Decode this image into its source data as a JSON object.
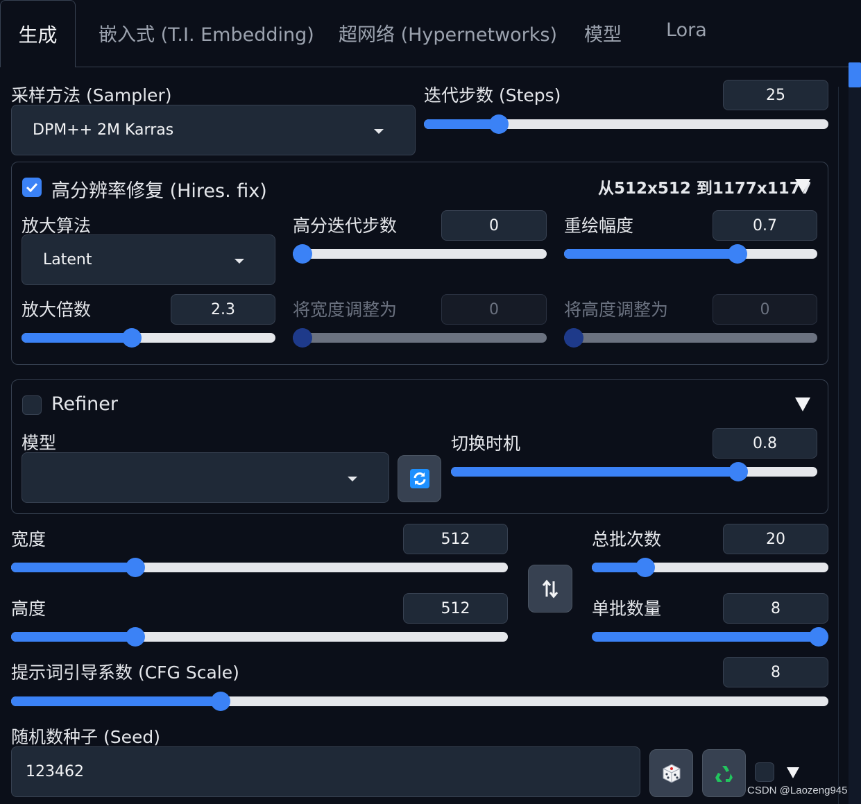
{
  "tabs": [
    {
      "label": "生成",
      "active": true
    },
    {
      "label": "嵌入式 (T.I. Embedding)"
    },
    {
      "label": "超网络 (Hypernetworks)"
    },
    {
      "label": "模型"
    },
    {
      "label": "Lora"
    }
  ],
  "sampler": {
    "label": "采样方法 (Sampler)",
    "value": "DPM++ 2M Karras"
  },
  "steps": {
    "label": "迭代步数 (Steps)",
    "value": "25",
    "level": 0.17
  },
  "hires": {
    "label": "高分辨率修复 (Hires. fix)",
    "checked": true,
    "summary": "从512x512 到1177x1177",
    "upscaler": {
      "label": "放大算法",
      "value": "Latent"
    },
    "hires_steps": {
      "label": "高分迭代步数",
      "value": "0",
      "level": 0.0
    },
    "denoise": {
      "label": "重绘幅度",
      "value": "0.7",
      "level": 0.7
    },
    "upscale_by": {
      "label": "放大倍数",
      "value": "2.3",
      "level": 0.43
    },
    "resize_w": {
      "label": "将宽度调整为",
      "value": "0",
      "level": 0.0
    },
    "resize_h": {
      "label": "将高度调整为",
      "value": "0",
      "level": 0.0
    }
  },
  "refiner": {
    "label": "Refiner",
    "checked": false,
    "model": {
      "label": "模型",
      "value": ""
    },
    "switch_at": {
      "label": "切换时机",
      "value": "0.8",
      "level": 0.8
    }
  },
  "width": {
    "label": "宽度",
    "value": "512",
    "level": 0.24
  },
  "height": {
    "label": "高度",
    "value": "512",
    "level": 0.24
  },
  "batch_count": {
    "label": "总批次数",
    "value": "20",
    "level": 0.2
  },
  "batch_size": {
    "label": "单批数量",
    "value": "8",
    "level": 1.0
  },
  "cfg": {
    "label": "提示词引导系数 (CFG Scale)",
    "value": "8",
    "level": 0.25
  },
  "seed": {
    "label": "随机数种子 (Seed)",
    "value": "123462"
  },
  "watermark": "CSDN @Laozeng945",
  "icons": [
    "check-icon",
    "refresh-icon",
    "swap-icon",
    "dice-icon",
    "recycle-icon",
    "caret-down-icon",
    "triangle-down-icon"
  ],
  "colors": {
    "background": "#0b0f19",
    "accent": "#3b82f6",
    "input": "#1f2937",
    "border": "#374151"
  }
}
